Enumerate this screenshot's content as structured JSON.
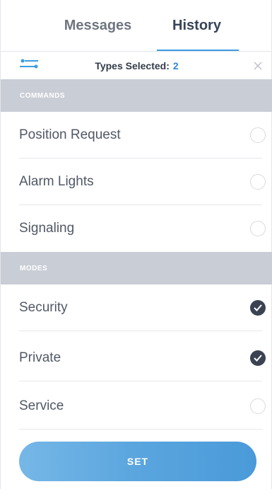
{
  "tabs": {
    "messages": "Messages",
    "history": "History"
  },
  "filter": {
    "types_label": "Types Selected:",
    "types_count": "2",
    "filter_icon": "filter-sliders-icon",
    "close_icon": "close-icon"
  },
  "sections": {
    "commands": {
      "title": "COMMANDS",
      "items": [
        {
          "label": "Position Request",
          "checked": false
        },
        {
          "label": "Alarm Lights",
          "checked": false
        },
        {
          "label": "Signaling",
          "checked": false
        }
      ]
    },
    "modes": {
      "title": "MODES",
      "items": [
        {
          "label": "Security",
          "checked": true
        },
        {
          "label": "Private",
          "checked": true
        },
        {
          "label": "Service",
          "checked": false
        }
      ]
    }
  },
  "set_button": {
    "label": "SET"
  },
  "colors": {
    "accent": "#3d9be0",
    "section_header": "#c9cdd5",
    "checked": "#3b4352",
    "button": "#5aa5de"
  }
}
